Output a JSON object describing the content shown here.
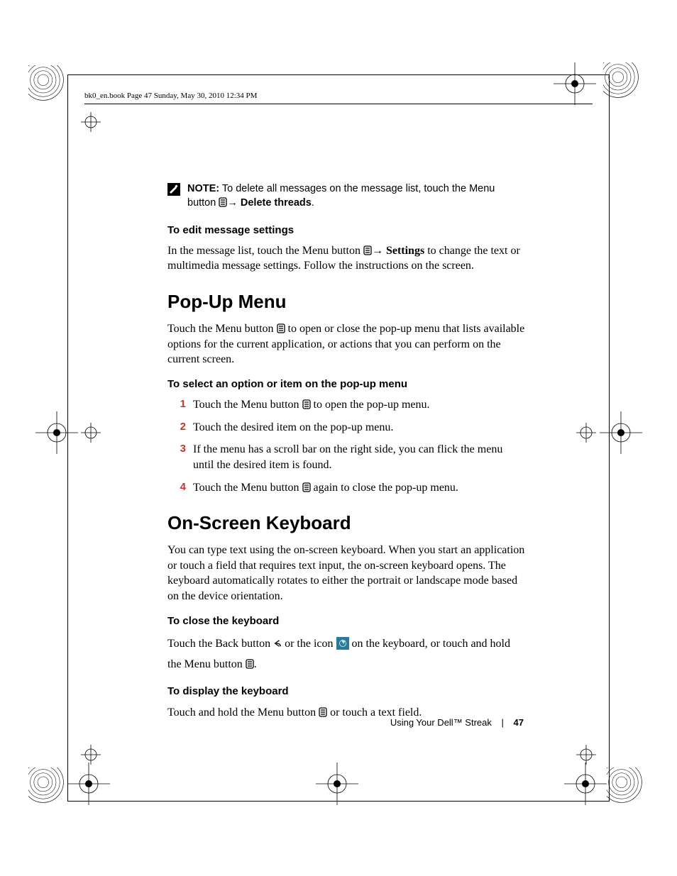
{
  "header": "bk0_en.book  Page 47  Sunday, May 30, 2010  12:34 PM",
  "note": {
    "label": "NOTE:",
    "text_a": " To delete all messages on the message list, touch the Menu button ",
    "text_b": "→ ",
    "bold": "Delete threads",
    "text_c": "."
  },
  "sub1": "To edit message settings",
  "para1a": "In the message list, touch the Menu button ",
  "para1b": "→ ",
  "para1_bold": "Settings",
  "para1c": " to change the text or multimedia message settings. Follow the instructions on the screen.",
  "h2a": "Pop-Up Menu",
  "para2a": "Touch the Menu button ",
  "para2b": " to open or close the pop-up menu that lists available options for the current application, or actions that you can perform on the current screen.",
  "sub2": "To select an option or item on the pop-up menu",
  "steps": [
    {
      "n": "1",
      "before": "Touch the Menu button ",
      "after": " to open the pop-up menu."
    },
    {
      "n": "2",
      "text": "Touch the desired item on the pop-up menu."
    },
    {
      "n": "3",
      "text": "If the menu has a scroll bar on the right side, you can flick the menu until the desired item is found."
    },
    {
      "n": "4",
      "before": "Touch the Menu button ",
      "after": " again to close the pop-up menu."
    }
  ],
  "h2b": "On-Screen Keyboard",
  "para3": "You can type text using the on-screen keyboard. When you start an application or touch a field that requires text input, the on-screen keyboard opens. The keyboard automatically rotates to either the portrait or landscape mode based on the device orientation.",
  "sub3": "To close the keyboard",
  "para4a": "Touch the Back button ",
  "para4b": " or the icon ",
  "para4c": " on the keyboard, or touch and hold the Menu button ",
  "para4d": ".",
  "sub4": "To display the keyboard",
  "para5a": "Touch and hold the Menu button ",
  "para5b": " or touch a text field.",
  "footer": {
    "label": "Using Your Dell™ Streak",
    "num": "47"
  }
}
